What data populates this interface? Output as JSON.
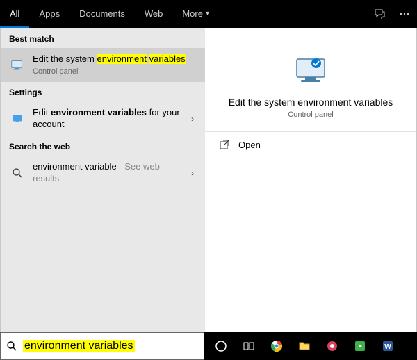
{
  "tabs": {
    "all": "All",
    "apps": "Apps",
    "documents": "Documents",
    "web": "Web",
    "more": "More"
  },
  "sections": {
    "best_match": "Best match",
    "settings": "Settings",
    "search_web": "Search the web"
  },
  "results": {
    "best": {
      "pre": "Edit the system ",
      "hl1": "environment",
      "mid": " ",
      "hl2": "variables",
      "sub": "Control panel"
    },
    "settings": {
      "pre": "Edit ",
      "hl": "environment variables",
      "post": " for your account"
    },
    "web": {
      "text": "environment variable",
      "hint": " - See web results"
    }
  },
  "preview": {
    "title": "Edit the system environment variables",
    "sub": "Control panel",
    "open": "Open"
  },
  "search": {
    "value": "environment variables"
  }
}
